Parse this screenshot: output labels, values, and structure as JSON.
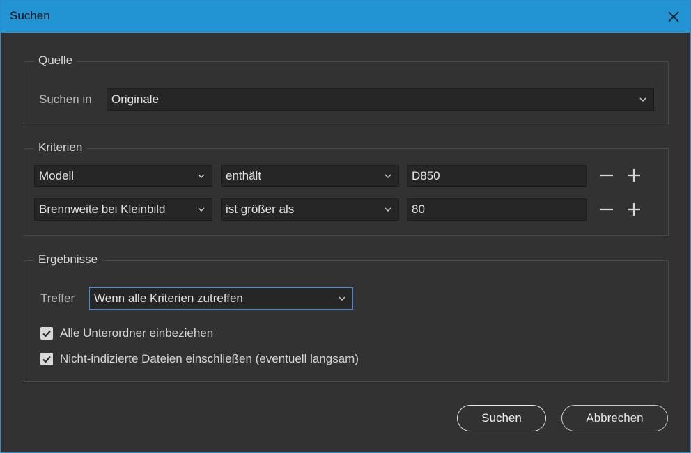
{
  "dialog": {
    "title": "Suchen",
    "close_icon": "close-icon"
  },
  "source": {
    "legend": "Quelle",
    "label": "Suchen in",
    "value": "Originale"
  },
  "criteria": {
    "legend": "Kriterien",
    "rows": [
      {
        "field": "Modell",
        "operator": "enthält",
        "value": "D850"
      },
      {
        "field": "Brennweite bei Kleinbild",
        "operator": "ist größer als",
        "value": "80"
      }
    ],
    "remove_icon": "minus-icon",
    "add_icon": "plus-icon"
  },
  "results": {
    "legend": "Ergebnisse",
    "match_label": "Treffer",
    "match_value": "Wenn alle Kriterien zutreffen",
    "checkboxes": [
      {
        "label": "Alle Unterordner einbeziehen",
        "checked": true
      },
      {
        "label": "Nicht-indizierte Dateien einschließen (eventuell langsam)",
        "checked": true
      }
    ]
  },
  "buttons": {
    "search": "Suchen",
    "cancel": "Abbrechen"
  },
  "colors": {
    "titlebar": "#2293d3",
    "background": "#323232",
    "field": "#262626",
    "focus": "#3a8ee6"
  }
}
